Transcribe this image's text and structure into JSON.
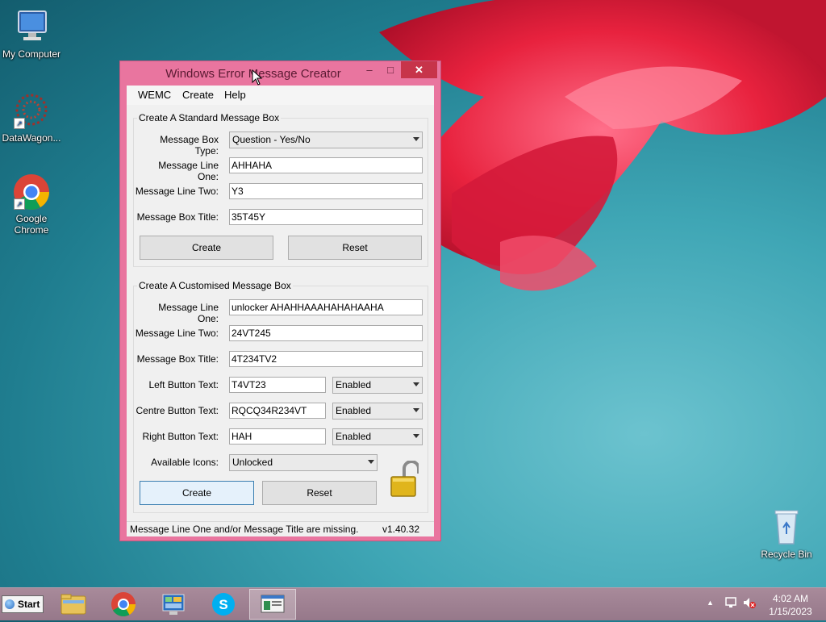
{
  "desktop": {
    "icons": [
      {
        "label": "My Computer",
        "icon": "monitor-icon"
      },
      {
        "label": "DataWagon...",
        "icon": "datawagon-icon"
      },
      {
        "label": "Google Chrome",
        "icon": "chrome-icon"
      },
      {
        "label": "Recycle Bin",
        "icon": "recycle-bin-icon"
      }
    ]
  },
  "window": {
    "title": "Windows Error Message Creator",
    "controls": {
      "minimize": "–",
      "maximize": "□",
      "close": "✕"
    },
    "menu": [
      "WEMC",
      "Create",
      "Help"
    ],
    "standard": {
      "group_title": "Create A Standard Message Box",
      "type_label": "Message Box Type:",
      "type_value": "Question - Yes/No",
      "line1_label": "Message Line One:",
      "line1_value": "AHHAHA",
      "line2_label": "Message Line Two:",
      "line2_value": "Y3",
      "title_label": "Message Box Title:",
      "title_value": "35T45Y",
      "create_label": "Create",
      "reset_label": "Reset"
    },
    "custom": {
      "group_title": "Create A Customised Message Box",
      "line1_label": "Message Line One:",
      "line1_value": "unlocker AHAHHAAAHAHAHAAHA",
      "line2_label": "Message Line Two:",
      "line2_value": "24VT245",
      "title_label": "Message Box Title:",
      "title_value": "4T234TV2",
      "left_label": "Left Button Text:",
      "left_value": "T4VT23",
      "left_state": "Enabled",
      "centre_label": "Centre Button Text:",
      "centre_value": "RQCQ34R234VT",
      "centre_state": "Enabled",
      "right_label": "Right Button Text:",
      "right_value": "HAH",
      "right_state": "Enabled",
      "icons_label": "Available Icons:",
      "icons_value": "Unlocked",
      "create_label": "Create",
      "reset_label": "Reset"
    },
    "status": {
      "message": "Message Line One and/or Message Title are missing.",
      "version": "v1.40.32"
    }
  },
  "taskbar": {
    "start_label": "Start",
    "tasks": [
      "file-explorer-icon",
      "chrome-icon",
      "control-panel-icon",
      "skype-icon",
      "wemc-app-icon"
    ],
    "clock_time": "4:02 AM",
    "clock_date": "1/15/2023"
  },
  "colors": {
    "window_frame": "#e9759f",
    "close_button": "#c7344a",
    "desktop": "#3fa6b5"
  }
}
